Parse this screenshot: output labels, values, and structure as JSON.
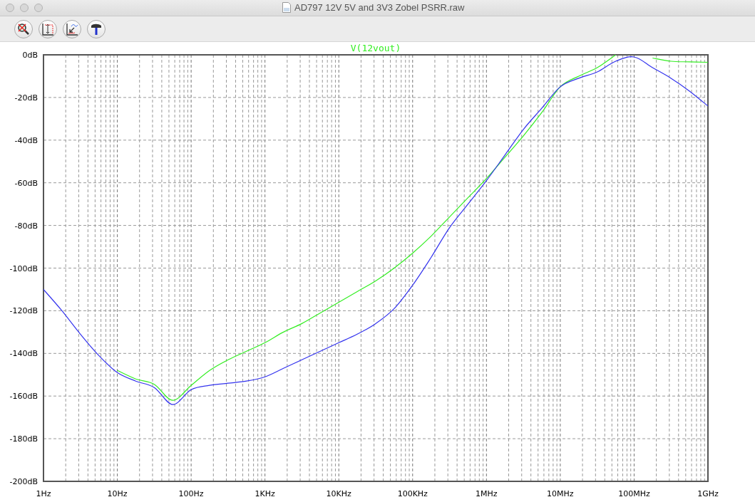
{
  "window": {
    "title": "AD797 12V 5V and 3V3 Zobel PSRR.raw"
  },
  "plot": {
    "chart_data": {
      "type": "line",
      "categories": [
        "1Hz",
        null,
        null,
        null,
        "10Hz",
        null,
        null,
        null,
        "100Hz",
        null,
        null,
        null,
        "1KHz",
        null,
        null,
        null,
        "10KHz",
        null,
        null,
        null,
        "100KHz",
        null,
        null,
        null,
        "1MHz",
        null,
        null,
        null,
        "10MHz",
        null,
        null,
        null,
        "100MHz",
        null,
        null,
        null,
        "1GHz"
      ],
      "series": [
        {
          "name": "V(12vout)",
          "color": "#33ee22",
          "values": [
            null,
            null,
            null,
            null,
            -148,
            -152,
            -154.5,
            -162,
            -155,
            -148,
            -143,
            -139,
            -135,
            -130,
            -126,
            -121,
            -116,
            -111,
            -106,
            -100,
            -93,
            -85,
            -76,
            -67,
            -58,
            -48,
            -38,
            -27,
            -15,
            -10,
            -6,
            0,
            null,
            -1.5,
            -3,
            -3.3,
            -3.5
          ]
        },
        {
          "color": "#3333ee",
          "values": [
            -110,
            -120,
            -131,
            -141,
            -149,
            -153,
            -156,
            -164,
            -157,
            -155,
            -154,
            -153,
            -151,
            -147,
            -143,
            -139,
            -135,
            -131,
            -126,
            -119,
            -108,
            -95,
            -81,
            -70,
            -59,
            -47,
            -35,
            -25,
            -15,
            -11,
            -8,
            -3,
            -1,
            -6,
            -11,
            -17,
            -24
          ]
        }
      ],
      "grid": true,
      "ylim": [
        -200,
        0
      ],
      "yticks": [
        {
          "value": 0,
          "label": "0dB"
        },
        {
          "value": -20,
          "label": "-20dB"
        },
        {
          "value": -40,
          "label": "-40dB"
        },
        {
          "value": -60,
          "label": "-60dB"
        },
        {
          "value": -80,
          "label": "-80dB"
        },
        {
          "value": -100,
          "label": "-100dB"
        },
        {
          "value": -120,
          "label": "-120dB"
        },
        {
          "value": -140,
          "label": "-140dB"
        },
        {
          "value": -160,
          "label": "-160dB"
        },
        {
          "value": -180,
          "label": "-180dB"
        },
        {
          "value": -200,
          "label": "-200dB"
        }
      ]
    }
  }
}
